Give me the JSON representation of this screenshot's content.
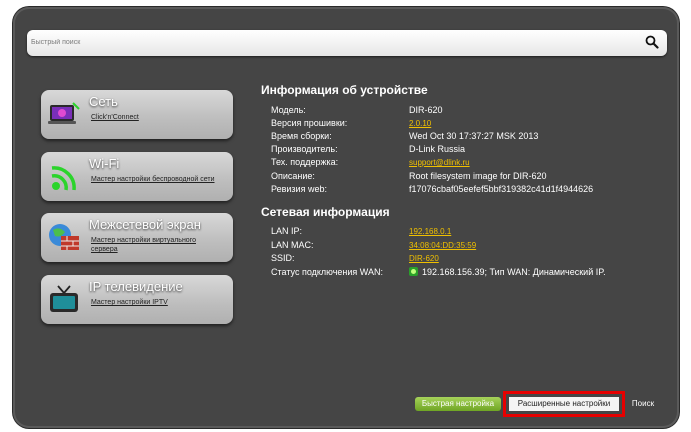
{
  "search": {
    "placeholder": "Быстрый поиск",
    "icon": "search-icon"
  },
  "tiles": [
    {
      "title": "Сеть",
      "link": "Click'n'Connect",
      "icon": "network-icon"
    },
    {
      "title": "Wi-Fi",
      "link": "Мастер настройки беспроводной сети",
      "icon": "wifi-icon"
    },
    {
      "title": "Межсетевой экран",
      "link": "Мастер настройки виртуального сервера",
      "icon": "firewall-icon"
    },
    {
      "title": "IP телевидение",
      "link": "Мастер настройки IPTV",
      "icon": "tv-icon"
    }
  ],
  "device_info": {
    "title": "Информация об устройстве",
    "rows": [
      {
        "label": "Модель:",
        "value": "DIR-620"
      },
      {
        "label": "Версия прошивки:",
        "value": "2.0.10"
      },
      {
        "label": "Время сборки:",
        "value": "Wed Oct 30 17:37:27 MSK 2013"
      },
      {
        "label": "Производитель:",
        "value": "D-Link Russia"
      },
      {
        "label": "Тех. поддержка:",
        "value": "support@dlink.ru"
      },
      {
        "label": "Описание:",
        "value": "Root filesystem image for DIR-620"
      },
      {
        "label": "Ревизия web:",
        "value": "f17076cbaf05eefef5bbf319382c41d1f4944626"
      }
    ]
  },
  "network_info": {
    "title": "Сетевая информация",
    "rows": [
      {
        "label": "LAN IP:",
        "value": "192.168.0.1"
      },
      {
        "label": "LAN MAC:",
        "value": "34:08:04:DD:35:59"
      },
      {
        "label": "SSID:",
        "value": "DIR-620"
      },
      {
        "label": "Статус подключения WAN:",
        "value": "192.168.156.39; Тип WAN: Динамический IP."
      }
    ]
  },
  "bottom": {
    "quick_label": "Быстрая настройка",
    "advanced_label": "Расширенные настройки",
    "search_label": "Поиск"
  },
  "colors": {
    "frame": "#454545",
    "link": "#f0c000",
    "accent_green": "#6fa524",
    "highlight": "#e60000"
  }
}
